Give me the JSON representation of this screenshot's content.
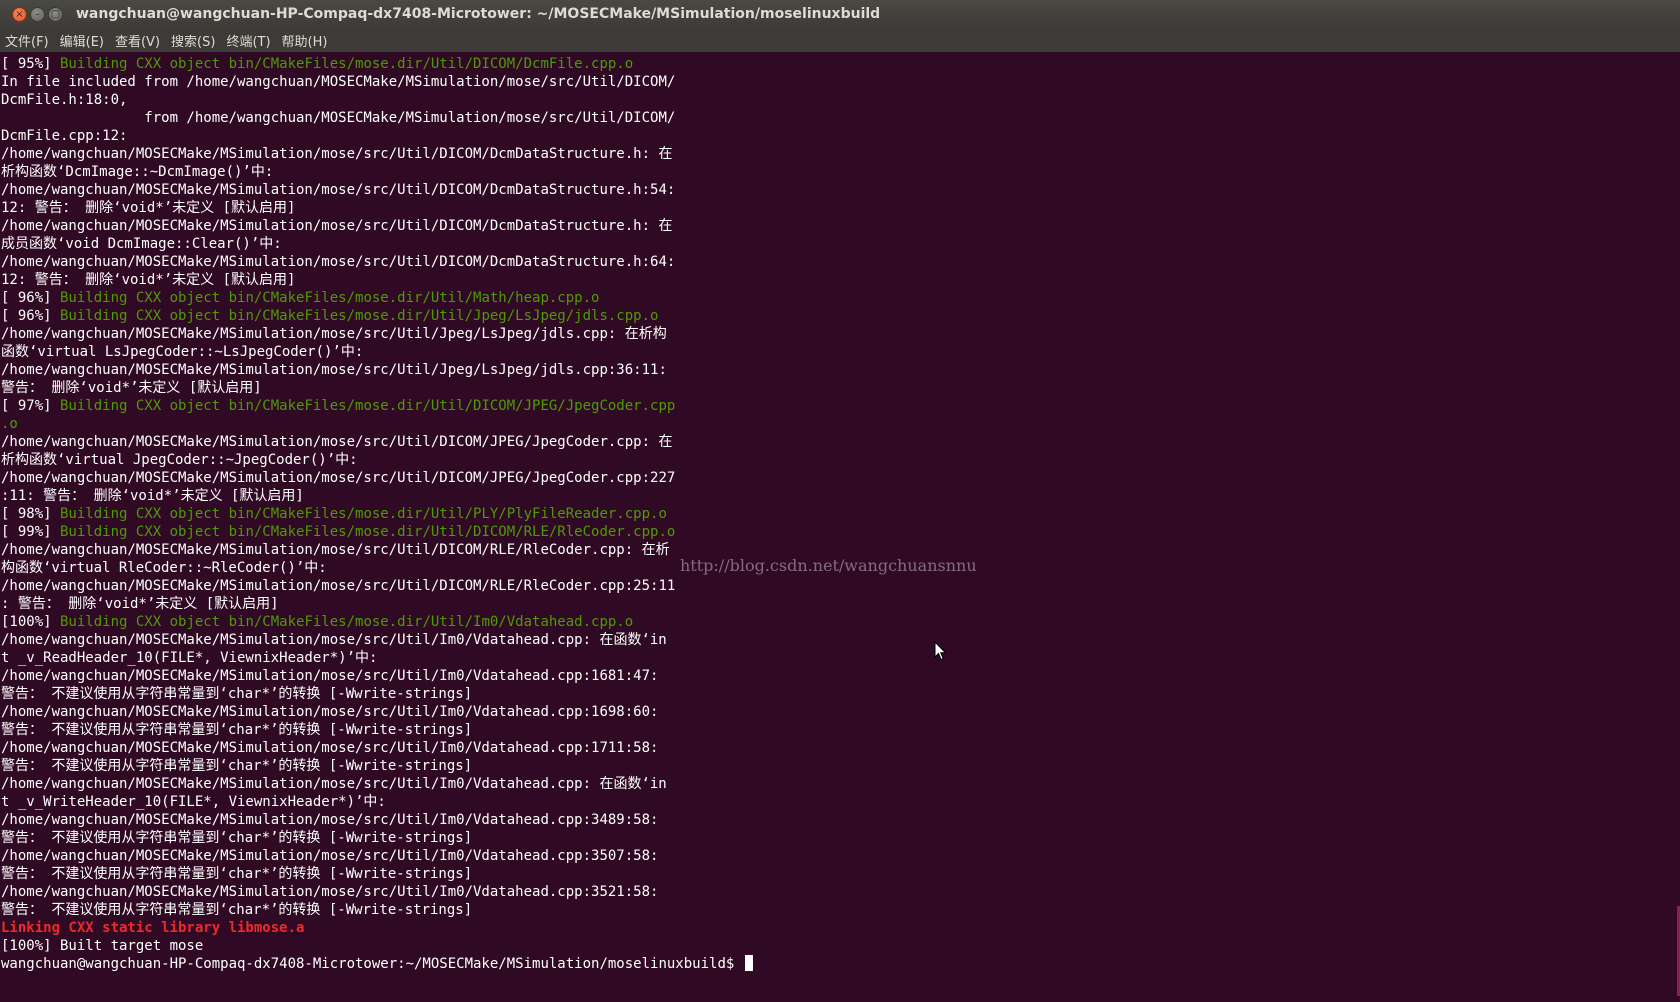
{
  "window": {
    "title": "wangchuan@wangchuan-HP-Compaq-dx7408-Microtower: ~/MOSECMake/MSimulation/moselinuxbuild",
    "buttons": {
      "close": "×",
      "minimize": "–",
      "maximize": "□"
    }
  },
  "menu": [
    "文件(F)",
    "编辑(E)",
    "查看(V)",
    "搜索(S)",
    "终端(T)",
    "帮助(H)"
  ],
  "colors": {
    "background": "#300a24",
    "text": "#ffffff",
    "build_step": "#4e9a06",
    "linking": "#ef2929"
  },
  "terminal": {
    "lines": [
      {
        "style": "green",
        "pct": "[ 95%]",
        "text": " Building CXX object bin/CMakeFiles/mose.dir/Util/DICOM/DcmFile.cpp.o"
      },
      {
        "style": "normal",
        "text": "In file included from /home/wangchuan/MOSECMake/MSimulation/mose/src/Util/DICOM/"
      },
      {
        "style": "normal",
        "text": "DcmFile.h:18:0,"
      },
      {
        "style": "normal",
        "text": "                 from /home/wangchuan/MOSECMake/MSimulation/mose/src/Util/DICOM/"
      },
      {
        "style": "normal",
        "text": "DcmFile.cpp:12:"
      },
      {
        "style": "normal",
        "text": "/home/wangchuan/MOSECMake/MSimulation/mose/src/Util/DICOM/DcmDataStructure.h: 在"
      },
      {
        "style": "normal",
        "text": "析构函数‘DcmImage::~DcmImage()’中:"
      },
      {
        "style": "normal",
        "text": "/home/wangchuan/MOSECMake/MSimulation/mose/src/Util/DICOM/DcmDataStructure.h:54:"
      },
      {
        "style": "normal",
        "text": "12: 警告： 删除‘void*’未定义 [默认启用]"
      },
      {
        "style": "normal",
        "text": "/home/wangchuan/MOSECMake/MSimulation/mose/src/Util/DICOM/DcmDataStructure.h: 在"
      },
      {
        "style": "normal",
        "text": "成员函数‘void DcmImage::Clear()’中:"
      },
      {
        "style": "normal",
        "text": "/home/wangchuan/MOSECMake/MSimulation/mose/src/Util/DICOM/DcmDataStructure.h:64:"
      },
      {
        "style": "normal",
        "text": "12: 警告： 删除‘void*’未定义 [默认启用]"
      },
      {
        "style": "green",
        "pct": "[ 96%]",
        "text": " Building CXX object bin/CMakeFiles/mose.dir/Util/Math/heap.cpp.o"
      },
      {
        "style": "green",
        "pct": "[ 96%]",
        "text": " Building CXX object bin/CMakeFiles/mose.dir/Util/Jpeg/LsJpeg/jdls.cpp.o"
      },
      {
        "style": "normal",
        "text": "/home/wangchuan/MOSECMake/MSimulation/mose/src/Util/Jpeg/LsJpeg/jdls.cpp: 在析构"
      },
      {
        "style": "normal",
        "text": "函数‘virtual LsJpegCoder::~LsJpegCoder()’中:"
      },
      {
        "style": "normal",
        "text": "/home/wangchuan/MOSECMake/MSimulation/mose/src/Util/Jpeg/LsJpeg/jdls.cpp:36:11:"
      },
      {
        "style": "normal",
        "text": "警告： 删除‘void*’未定义 [默认启用]"
      },
      {
        "style": "green",
        "pct": "[ 97%]",
        "text": " Building CXX object bin/CMakeFiles/mose.dir/Util/DICOM/JPEG/JpegCoder.cpp"
      },
      {
        "style": "green",
        "text": ".o"
      },
      {
        "style": "normal",
        "text": "/home/wangchuan/MOSECMake/MSimulation/mose/src/Util/DICOM/JPEG/JpegCoder.cpp: 在"
      },
      {
        "style": "normal",
        "text": "析构函数‘virtual JpegCoder::~JpegCoder()’中:"
      },
      {
        "style": "normal",
        "text": "/home/wangchuan/MOSECMake/MSimulation/mose/src/Util/DICOM/JPEG/JpegCoder.cpp:227"
      },
      {
        "style": "normal",
        "text": ":11: 警告： 删除‘void*’未定义 [默认启用]"
      },
      {
        "style": "green",
        "pct": "[ 98%]",
        "text": " Building CXX object bin/CMakeFiles/mose.dir/Util/PLY/PlyFileReader.cpp.o"
      },
      {
        "style": "green",
        "pct": "[ 99%]",
        "text": " Building CXX object bin/CMakeFiles/mose.dir/Util/DICOM/RLE/RleCoder.cpp.o"
      },
      {
        "style": "normal",
        "text": "/home/wangchuan/MOSECMake/MSimulation/mose/src/Util/DICOM/RLE/RleCoder.cpp: 在析"
      },
      {
        "style": "normal",
        "text": "构函数‘virtual RleCoder::~RleCoder()’中:"
      },
      {
        "style": "normal",
        "text": "/home/wangchuan/MOSECMake/MSimulation/mose/src/Util/DICOM/RLE/RleCoder.cpp:25:11"
      },
      {
        "style": "normal",
        "text": ": 警告： 删除‘void*’未定义 [默认启用]"
      },
      {
        "style": "green",
        "pct": "[100%]",
        "text": " Building CXX object bin/CMakeFiles/mose.dir/Util/Im0/Vdatahead.cpp.o"
      },
      {
        "style": "normal",
        "text": "/home/wangchuan/MOSECMake/MSimulation/mose/src/Util/Im0/Vdatahead.cpp: 在函数‘in"
      },
      {
        "style": "normal",
        "text": "t _v_ReadHeader_10(FILE*, ViewnixHeader*)’中:"
      },
      {
        "style": "normal",
        "text": "/home/wangchuan/MOSECMake/MSimulation/mose/src/Util/Im0/Vdatahead.cpp:1681:47:"
      },
      {
        "style": "normal",
        "text": "警告： 不建议使用从字符串常量到‘char*’的转换 [-Wwrite-strings]"
      },
      {
        "style": "normal",
        "text": "/home/wangchuan/MOSECMake/MSimulation/mose/src/Util/Im0/Vdatahead.cpp:1698:60:"
      },
      {
        "style": "normal",
        "text": "警告： 不建议使用从字符串常量到‘char*’的转换 [-Wwrite-strings]"
      },
      {
        "style": "normal",
        "text": "/home/wangchuan/MOSECMake/MSimulation/mose/src/Util/Im0/Vdatahead.cpp:1711:58:"
      },
      {
        "style": "normal",
        "text": "警告： 不建议使用从字符串常量到‘char*’的转换 [-Wwrite-strings]"
      },
      {
        "style": "normal",
        "text": "/home/wangchuan/MOSECMake/MSimulation/mose/src/Util/Im0/Vdatahead.cpp: 在函数‘in"
      },
      {
        "style": "normal",
        "text": "t _v_WriteHeader_10(FILE*, ViewnixHeader*)’中:"
      },
      {
        "style": "normal",
        "text": "/home/wangchuan/MOSECMake/MSimulation/mose/src/Util/Im0/Vdatahead.cpp:3489:58:"
      },
      {
        "style": "normal",
        "text": "警告： 不建议使用从字符串常量到‘char*’的转换 [-Wwrite-strings]"
      },
      {
        "style": "normal",
        "text": "/home/wangchuan/MOSECMake/MSimulation/mose/src/Util/Im0/Vdatahead.cpp:3507:58:"
      },
      {
        "style": "normal",
        "text": "警告： 不建议使用从字符串常量到‘char*’的转换 [-Wwrite-strings]"
      },
      {
        "style": "normal",
        "text": "/home/wangchuan/MOSECMake/MSimulation/mose/src/Util/Im0/Vdatahead.cpp:3521:58:"
      },
      {
        "style": "normal",
        "text": "警告： 不建议使用从字符串常量到‘char*’的转换 [-Wwrite-strings]"
      },
      {
        "style": "red",
        "text": "Linking CXX static library libmose.a"
      },
      {
        "style": "normal",
        "text": "[100%] Built target mose"
      }
    ],
    "prompt": "wangchuan@wangchuan-HP-Compaq-dx7408-Microtower:~/MOSECMake/MSimulation/moselinuxbuild$ "
  },
  "watermark": "http://blog.csdn.net/wangchuansnnu",
  "icons": {
    "pointer": "mouse-pointer-icon"
  }
}
